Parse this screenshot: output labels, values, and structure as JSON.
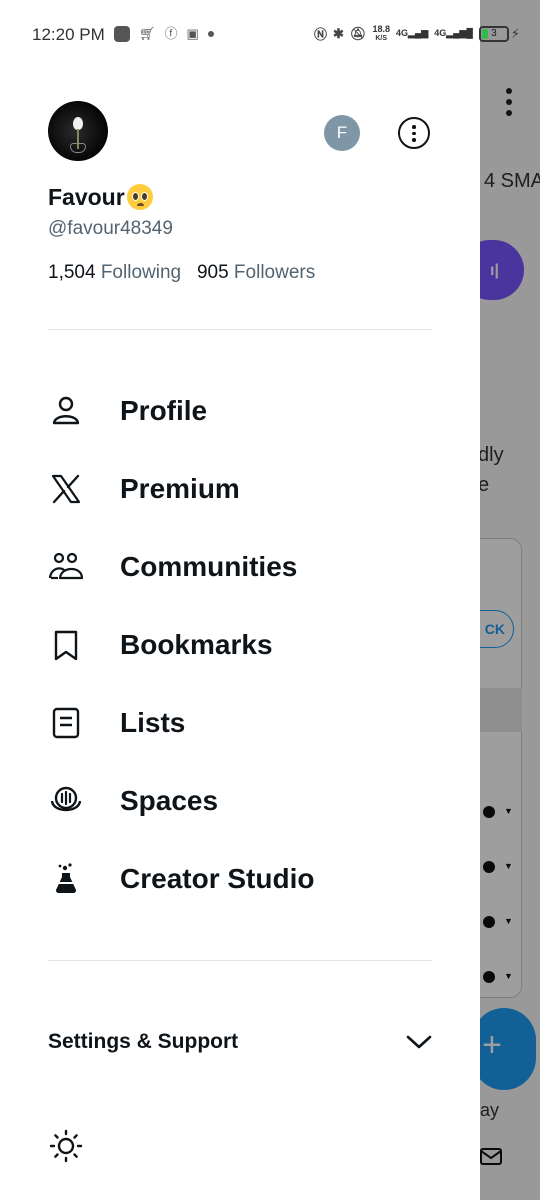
{
  "status_bar": {
    "time": "12:20 PM",
    "speed_value": "18.8",
    "speed_unit": "K/S",
    "network_1": "4G",
    "network_2": "4G",
    "battery": "3"
  },
  "profile": {
    "display_name": "Favour",
    "handle": "@favour48349",
    "following_count": "1,504",
    "following_label": "Following",
    "followers_count": "905",
    "followers_label": "Followers",
    "account_initial": "F"
  },
  "menu": [
    {
      "label": "Profile",
      "icon": "person-icon"
    },
    {
      "label": "Premium",
      "icon": "x-logo-icon"
    },
    {
      "label": "Communities",
      "icon": "communities-icon"
    },
    {
      "label": "Bookmarks",
      "icon": "bookmark-icon"
    },
    {
      "label": "Lists",
      "icon": "lists-icon"
    },
    {
      "label": "Spaces",
      "icon": "spaces-icon"
    },
    {
      "label": "Creator Studio",
      "icon": "creator-studio-icon"
    }
  ],
  "settings": {
    "label": "Settings & Support"
  },
  "background": {
    "partial_text_1": "4 SMA",
    "partial_text_2": "dly",
    "partial_text_3": "e",
    "partial_text_4": "CK",
    "partial_text_5": "ay"
  },
  "colors": {
    "accent": "#1d9bf0",
    "text_primary": "#0f1419",
    "text_secondary": "#536471",
    "avatar_switch": "#7f96a7",
    "spaces_purple": "#7856ff"
  }
}
